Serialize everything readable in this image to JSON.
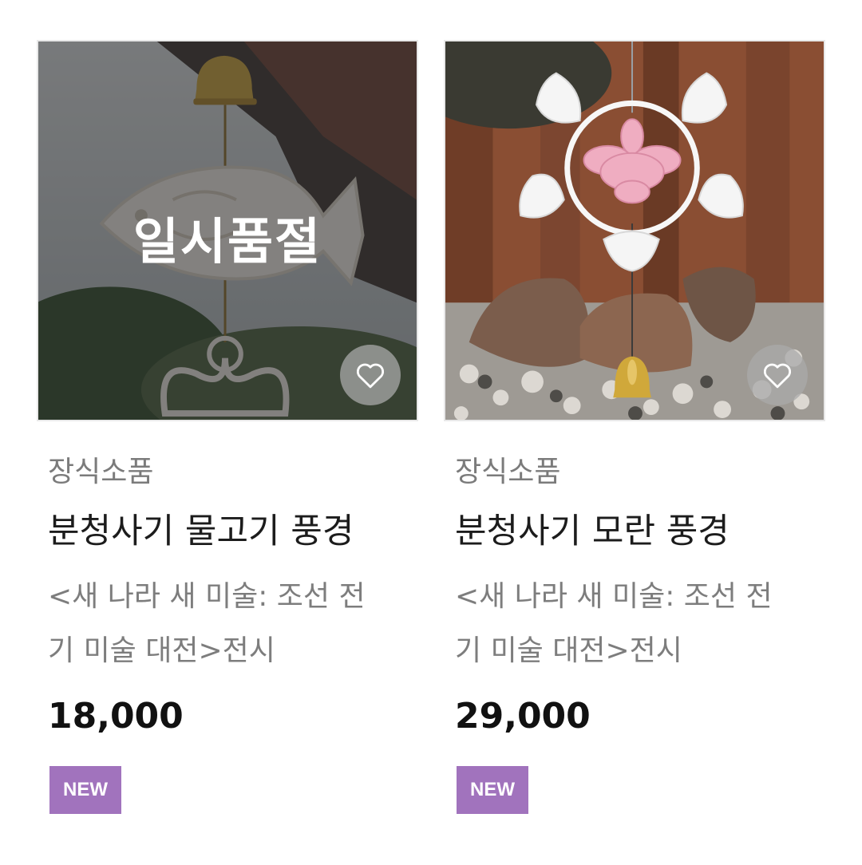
{
  "products": [
    {
      "image_alt": "분청사기 물고기 풍경",
      "soldout_label": "일시품절",
      "category": "장식소품",
      "name": "분청사기 물고기 풍경",
      "description": "<새 나라 새 미술: 조선 전기 미술 대전>전시",
      "price": "18,000",
      "badge": "NEW",
      "wishlist_icon": "heart-outline-icon"
    },
    {
      "image_alt": "분청사기 모란 풍경",
      "category": "장식소품",
      "name": "분청사기 모란 풍경",
      "description": "<새 나라 새 미술: 조선 전기 미술 대전>전시",
      "price": "29,000",
      "badge": "NEW",
      "wishlist_icon": "heart-outline-icon"
    }
  ],
  "colors": {
    "badge_bg": "#a173bd",
    "price_text": "#111111",
    "category_text": "#7b7b7b"
  }
}
